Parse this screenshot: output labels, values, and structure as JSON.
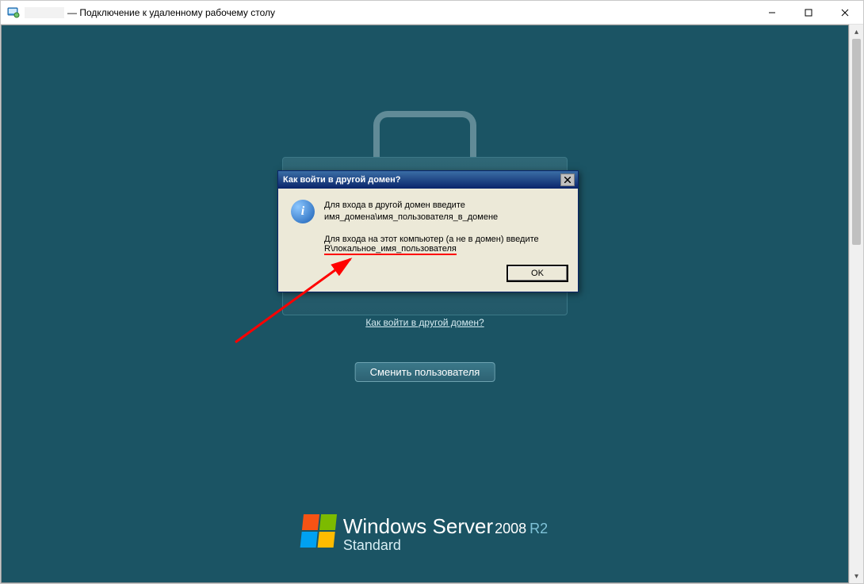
{
  "window": {
    "title_suffix": "— Подключение к удаленному рабочему столу"
  },
  "login": {
    "domain_link": "Как войти в другой домен?",
    "switch_user": "Сменить пользователя"
  },
  "brand": {
    "line1_a": "Windows",
    "line1_b": "Server",
    "year": "2008",
    "r2": "R2",
    "line2": "Standard"
  },
  "dialog": {
    "title": "Как войти в другой домен?",
    "info_glyph": "i",
    "p1_l1": "Для входа в другой домен введите",
    "p1_l2": "имя_домена\\имя_пользователя_в_домене",
    "p2_l1": "Для входа на этот компьютер (а не в домен) введите",
    "p2_l2_suffix": "R\\локальное_имя_пользователя",
    "ok": "OK"
  }
}
